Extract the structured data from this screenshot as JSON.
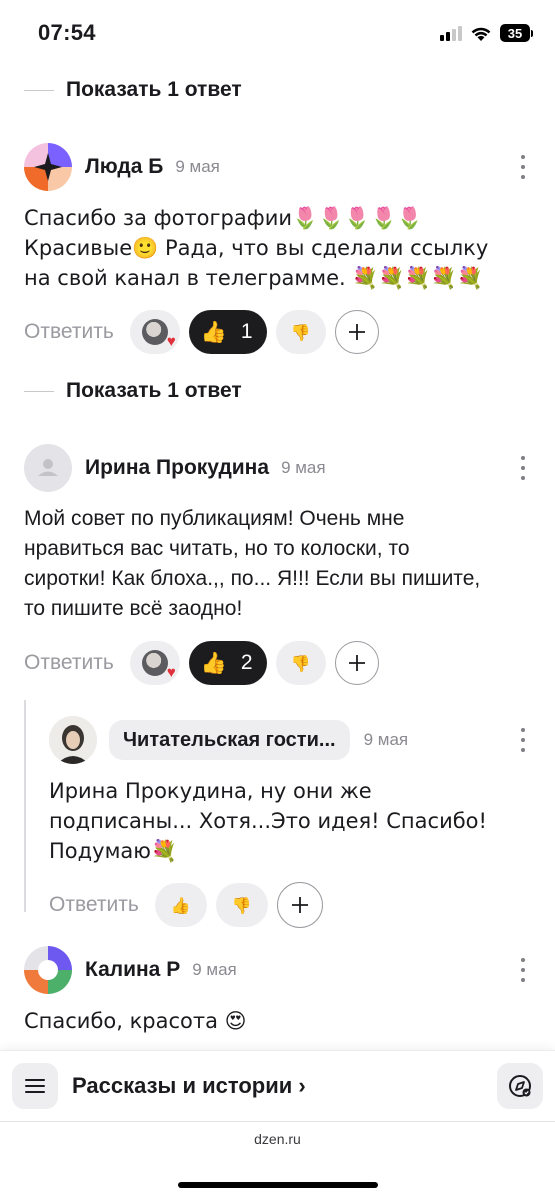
{
  "status_bar": {
    "time": "07:54",
    "battery": "35"
  },
  "show_replies_label": "Показать 1 ответ",
  "show_replies_label_2": "Показать 1 ответ",
  "reply_label": "Ответить",
  "comments": [
    {
      "author": "Люда Б",
      "date": "9 мая",
      "text": "Спасибо за фотографии🌷🌷🌷🌷🌷 Красивые🙂 Рада, что вы сделали ссылку на свой канал в телеграмме. 💐💐💐💐💐",
      "likes": "1"
    },
    {
      "author": "Ирина Прокудина",
      "date": "9 мая",
      "text": "Мой совет по публикациям! Очень мне нравиться вас читать, но то колоски, то сиротки! Как блоха.,, по... Я!!! Если вы пишите, то пишите всё заодно!",
      "likes": "2"
    },
    {
      "author": "Читательская гости...",
      "date": "9 мая",
      "text": "Ирина Прокудина, ну они же подписаны... Хотя...Это идея! Спасибо! Подумаю💐"
    },
    {
      "author": "Калина Р",
      "date": "9 мая",
      "text": "Спасибо, красота 😍"
    }
  ],
  "bottom_bar": {
    "channel_title": "Рассказы и истории ›",
    "domain": "dzen.ru"
  },
  "icons": {
    "like": "thumbs-up-icon",
    "dislike": "thumbs-down-icon",
    "add_reaction": "plus-icon",
    "menu": "hamburger-icon",
    "compass": "compass-icon"
  },
  "colors": {
    "dark_pill": "#1c1c1e",
    "pill": "#eeeef0",
    "muted_text": "#9a9aa0"
  }
}
